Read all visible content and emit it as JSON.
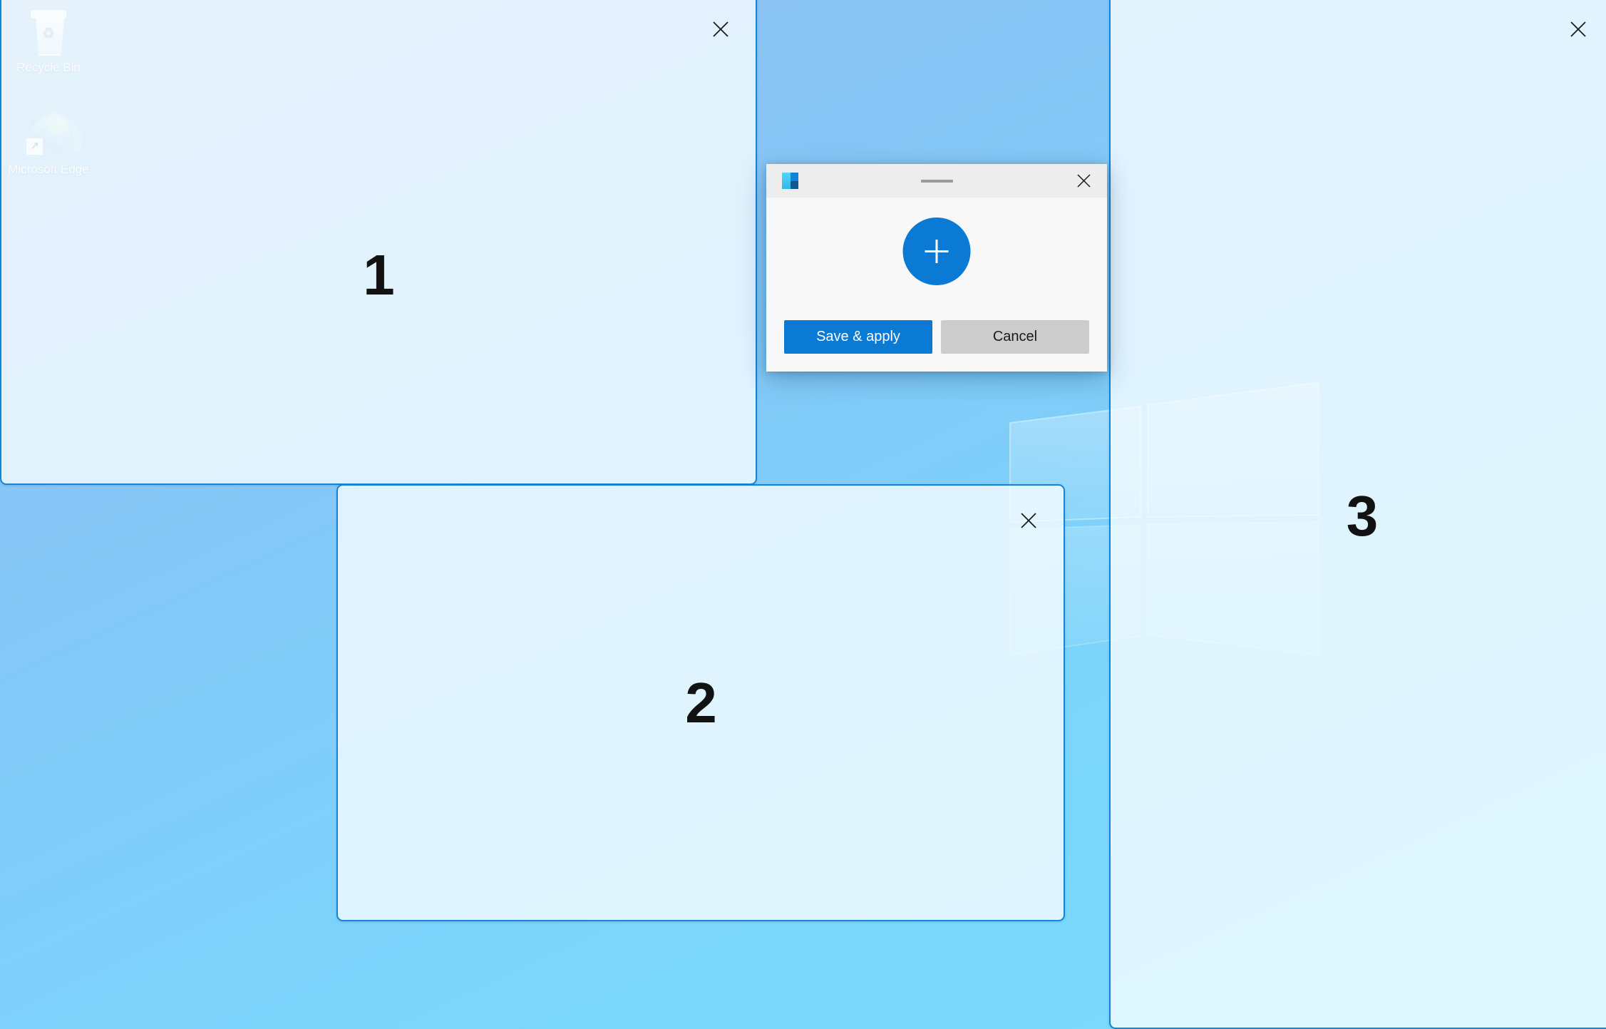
{
  "desktop": {
    "icons": [
      {
        "name": "recycle-bin",
        "label": "Recycle Bin",
        "icon": "recycle-bin-icon"
      },
      {
        "name": "microsoft-edge",
        "label": "Microsoft Edge",
        "icon": "edge-browser-icon"
      }
    ],
    "wallpaper": {
      "description": "Windows bloom gradient wallpaper with translucent four-pane window logo",
      "gradient_from": "#9cc7f0",
      "gradient_to": "#79dbfd"
    }
  },
  "zones": {
    "accent_color": "#1285d8",
    "fill_color": "#e2f1fb",
    "close_icon": "close-x-icon",
    "items": [
      {
        "id": 1,
        "number": "1",
        "close_label": "Close zone 1"
      },
      {
        "id": 2,
        "number": "2",
        "close_label": "Close zone 2"
      },
      {
        "id": 3,
        "number": "3",
        "close_label": "Close zone 3"
      }
    ]
  },
  "dialog": {
    "app_icon": "fancyzones-icon",
    "title": "",
    "minimize_icon": "minimize-icon",
    "close_icon": "close-x-icon",
    "add_zone": {
      "icon": "plus-icon",
      "label": "Add zone"
    },
    "buttons": {
      "save_label": "Save & apply",
      "cancel_label": "Cancel"
    },
    "colors": {
      "primary": "#0a7ad4",
      "secondary": "#cccccc",
      "titlebar": "#ededed",
      "body": "#f8f8f8"
    }
  }
}
